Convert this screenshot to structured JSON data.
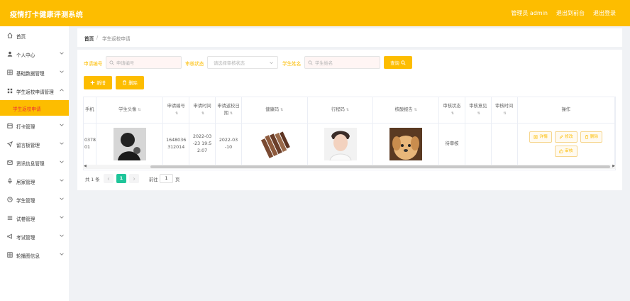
{
  "header": {
    "title": "疫情打卡健康评测系统",
    "admin_label": "管理员 admin",
    "to_frontend": "退出到前台",
    "logout": "退出登录"
  },
  "sidebar": {
    "items": [
      {
        "label": "首页",
        "icon": "home-icon"
      },
      {
        "label": "个人中心",
        "icon": "user-icon"
      },
      {
        "label": "基础数据管理",
        "icon": "grid-icon"
      },
      {
        "label": "学生返校申请管理",
        "icon": "apps-icon"
      },
      {
        "label": "学生返校申请",
        "icon": ""
      },
      {
        "label": "打卡管理",
        "icon": "calendar-icon"
      },
      {
        "label": "留言板管理",
        "icon": "send-icon"
      },
      {
        "label": "资讯信息管理",
        "icon": "mail-icon"
      },
      {
        "label": "居家管理",
        "icon": "mic-icon"
      },
      {
        "label": "学生管理",
        "icon": "clock-icon"
      },
      {
        "label": "试卷管理",
        "icon": "list-icon"
      },
      {
        "label": "考试管理",
        "icon": "megaphone-icon"
      },
      {
        "label": "轮播图信息",
        "icon": "grid-icon"
      }
    ]
  },
  "breadcrumb": {
    "home": "首页",
    "separator": "/",
    "current": "学生返校申请"
  },
  "filters": {
    "apply_no_label": "申请编号",
    "apply_no_placeholder": "申请编号",
    "status_label": "审核状态",
    "status_placeholder": "请选择审核状态",
    "name_label": "学生姓名",
    "name_placeholder": "学生姓名",
    "query_button": "查询"
  },
  "toolbar": {
    "add_button": "新增",
    "delete_button": "删除"
  },
  "table": {
    "headers": [
      "手机",
      "学生头像",
      "申请编号",
      "申请时间",
      "申请返校日期",
      "健康码",
      "行程码",
      "核酸报告",
      "审核状态",
      "审核意见",
      "审核时间",
      "操作"
    ],
    "rows": [
      {
        "phone": "0378\n01",
        "apply_no": "1648036\n312014",
        "apply_time": "2022-03\n-23 19:5\n2:07",
        "return_date": "2022-03\n-10",
        "status": "待审核",
        "opinion": "",
        "audit_time": ""
      }
    ],
    "actions": {
      "detail": "详情",
      "edit": "修改",
      "delete": "删除",
      "audit": "审核"
    }
  },
  "pagination": {
    "total": "共 1 条",
    "current_page": "1",
    "goto_label": "前往",
    "goto_value": "1",
    "page_label": "页"
  },
  "colors": {
    "primary": "#fdbd00",
    "active_page": "#1fc59a",
    "active_menu_text": "#e33333"
  }
}
